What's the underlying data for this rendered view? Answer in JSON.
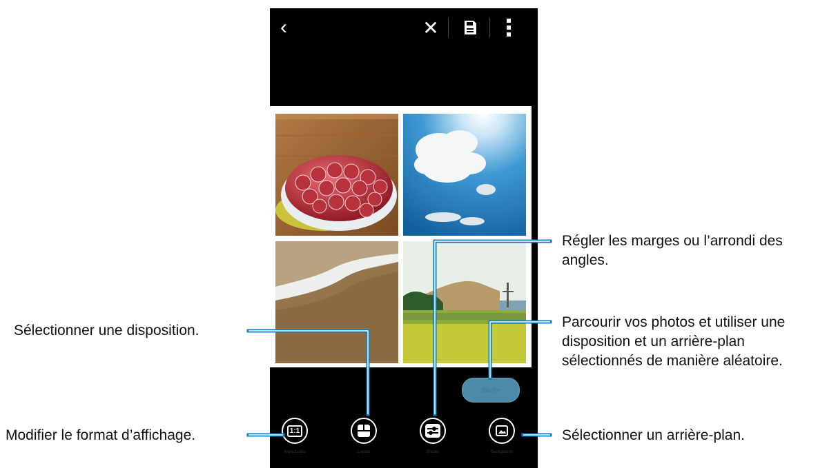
{
  "topbar": {
    "back_icon": "back-arrow-icon",
    "close_icon": "close-icon",
    "save_icon": "save-icon",
    "more_icon": "more-options-icon"
  },
  "collage": {
    "photos": [
      "strawberry-tart-photo",
      "sky-cloud-photo",
      "beach-wave-photo",
      "coastal-landscape-photo"
    ]
  },
  "shuffle": {
    "label": "Shuffle"
  },
  "toolbar": {
    "items": [
      {
        "icon": "aspect-ratio-icon",
        "glyph": "1:1",
        "label": "Aspect ratio"
      },
      {
        "icon": "layout-icon",
        "label": "Layout"
      },
      {
        "icon": "border-icon",
        "label": "Border"
      },
      {
        "icon": "background-icon",
        "label": "Background"
      }
    ]
  },
  "callouts": {
    "border": [
      "Régler les marges ou l’arrondi des",
      "angles."
    ],
    "layout": "Sélectionner une disposition.",
    "shuffle": [
      "Parcourir vos photos et utiliser une",
      "disposition et un arrière-plan",
      "sélectionnés de manière aléatoire."
    ],
    "aspect": "Modifier le format d’affichage.",
    "background": "Sélectionner un arrière-plan."
  },
  "colors": {
    "callout_line": "#0f7fbf",
    "screen": "#000000",
    "accent": "#4d8aa6"
  }
}
